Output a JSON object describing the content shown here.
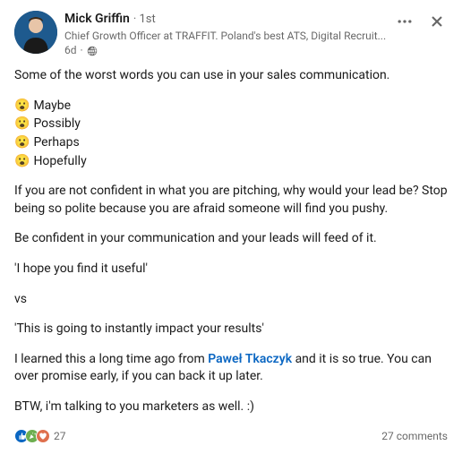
{
  "author": {
    "name": "Mick Griffin",
    "connection": "· 1st",
    "headline": "Chief Growth Officer at TRAFFIT. Poland's best ATS, Digital Recruit...",
    "time": "6d",
    "time_sep": "·"
  },
  "content": {
    "intro": "Some of the worst words you can use in your sales communication.",
    "words": [
      "Maybe",
      "Possibly",
      "Perhaps",
      "Hopefully"
    ],
    "emoji": "😮",
    "para2": "If you are not confident in what you are pitching, why would your lead be? Stop being so polite because you are afraid someone will find you pushy.",
    "para3": "Be confident in your communication and your leads will feed of it.",
    "example1": "'I hope you find it useful'",
    "vs": "vs",
    "example2": "'This is going to instantly impact your results'",
    "para4_a": "I learned this a long time ago from ",
    "mention": "Paweł Tkaczyk",
    "para4_b": " and it is so true. You can over promise early, if you can back it up later.",
    "outro": "BTW, i'm talking to you marketers as well. :)"
  },
  "stats": {
    "reaction_count": "27",
    "comments": "27 comments"
  }
}
